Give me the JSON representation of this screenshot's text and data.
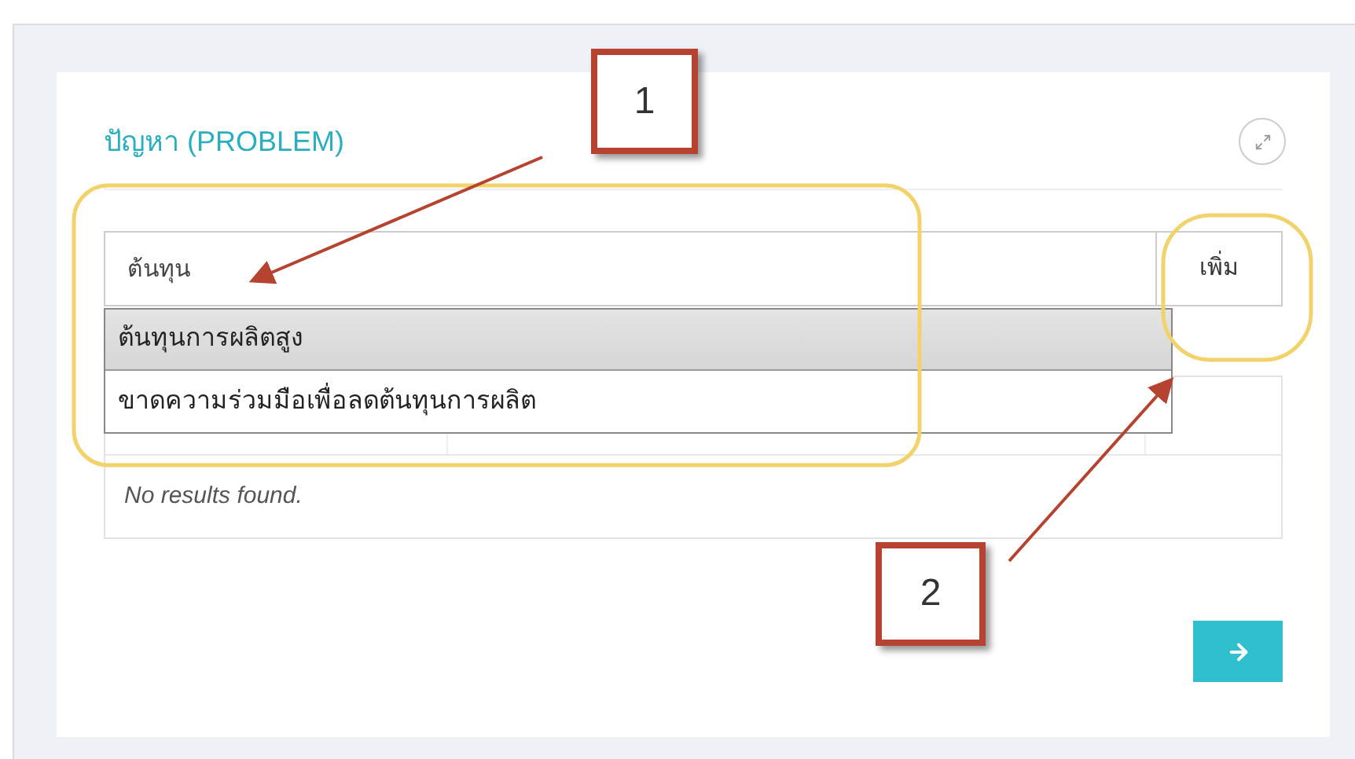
{
  "panel": {
    "title": "ปัญหา (PROBLEM)",
    "search": {
      "value": "ต้นทุน"
    },
    "add_button": "เพิ่ม",
    "suggestions": [
      {
        "label": "ต้นทุนการผลิตสูง",
        "selected": true
      },
      {
        "label": "ขาดความร่วมมือเพื่อลดต้นทุนการผลิต",
        "selected": false
      }
    ],
    "table": {
      "empty_message": "No results found."
    }
  },
  "annotations": [
    {
      "label": "1"
    },
    {
      "label": "2"
    }
  ]
}
